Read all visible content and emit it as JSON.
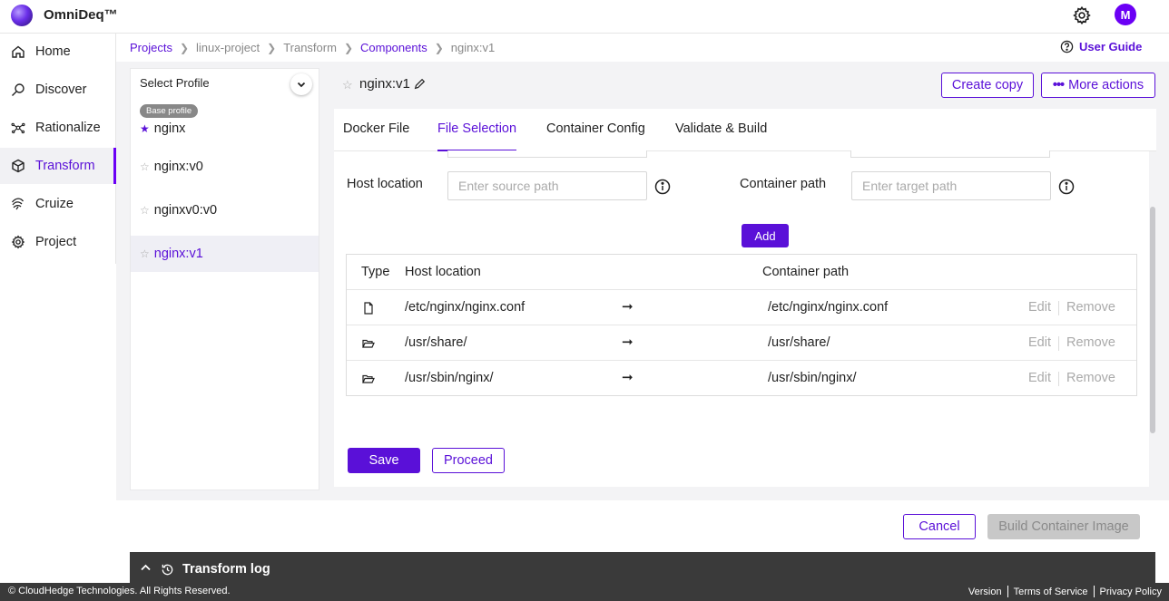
{
  "app": {
    "brand": "OmniDeq™",
    "avatar_letter": "M"
  },
  "sidebar": {
    "items": [
      {
        "label": "Home",
        "icon": "home-icon"
      },
      {
        "label": "Discover",
        "icon": "discover-icon"
      },
      {
        "label": "Rationalize",
        "icon": "rationalize-icon"
      },
      {
        "label": "Transform",
        "icon": "cube-icon",
        "active": true
      },
      {
        "label": "Cruize",
        "icon": "cruize-icon"
      },
      {
        "label": "Project",
        "icon": "gear-icon"
      }
    ]
  },
  "breadcrumb": [
    "Projects",
    "linux-project",
    "Transform",
    "Components",
    "nginx:v1"
  ],
  "user_guide": "User Guide",
  "profiles": {
    "select_label": "Select Profile",
    "base_badge": "Base profile",
    "items": [
      "nginx",
      "nginx:v0",
      "nginxv0:v0",
      "nginx:v1"
    ]
  },
  "header": {
    "title": "nginx:v1",
    "create_copy": "Create copy",
    "more_actions": "More actions"
  },
  "tabs": [
    "Docker File",
    "File Selection",
    "Container Config",
    "Validate & Build"
  ],
  "form": {
    "host_label": "Host location",
    "host_placeholder": "Enter source path",
    "container_label": "Container path",
    "container_placeholder": "Enter target path",
    "add": "Add"
  },
  "table": {
    "headers": {
      "type": "Type",
      "host": "Host location",
      "container": "Container path"
    },
    "rows": [
      {
        "type": "file",
        "host": "/etc/nginx/nginx.conf",
        "container": "/etc/nginx/nginx.conf"
      },
      {
        "type": "folder",
        "host": "/usr/share/",
        "container": "/usr/share/"
      },
      {
        "type": "folder",
        "host": "/usr/sbin/nginx/",
        "container": "/usr/sbin/nginx/"
      }
    ],
    "arrow": "➞",
    "edit": "Edit",
    "remove": "Remove"
  },
  "actions": {
    "save": "Save",
    "proceed": "Proceed",
    "cancel": "Cancel",
    "build": "Build Container Image"
  },
  "log": {
    "title": "Transform log"
  },
  "footer": {
    "copyright": "© CloudHedge Technologies. All Rights Reserved.",
    "links": [
      "Version",
      "Terms of Service",
      "Privacy Policy"
    ]
  },
  "colors": {
    "accent": "#5a10d8",
    "avatar": "#6b00f5",
    "dark_bar": "#3a3a3a"
  }
}
